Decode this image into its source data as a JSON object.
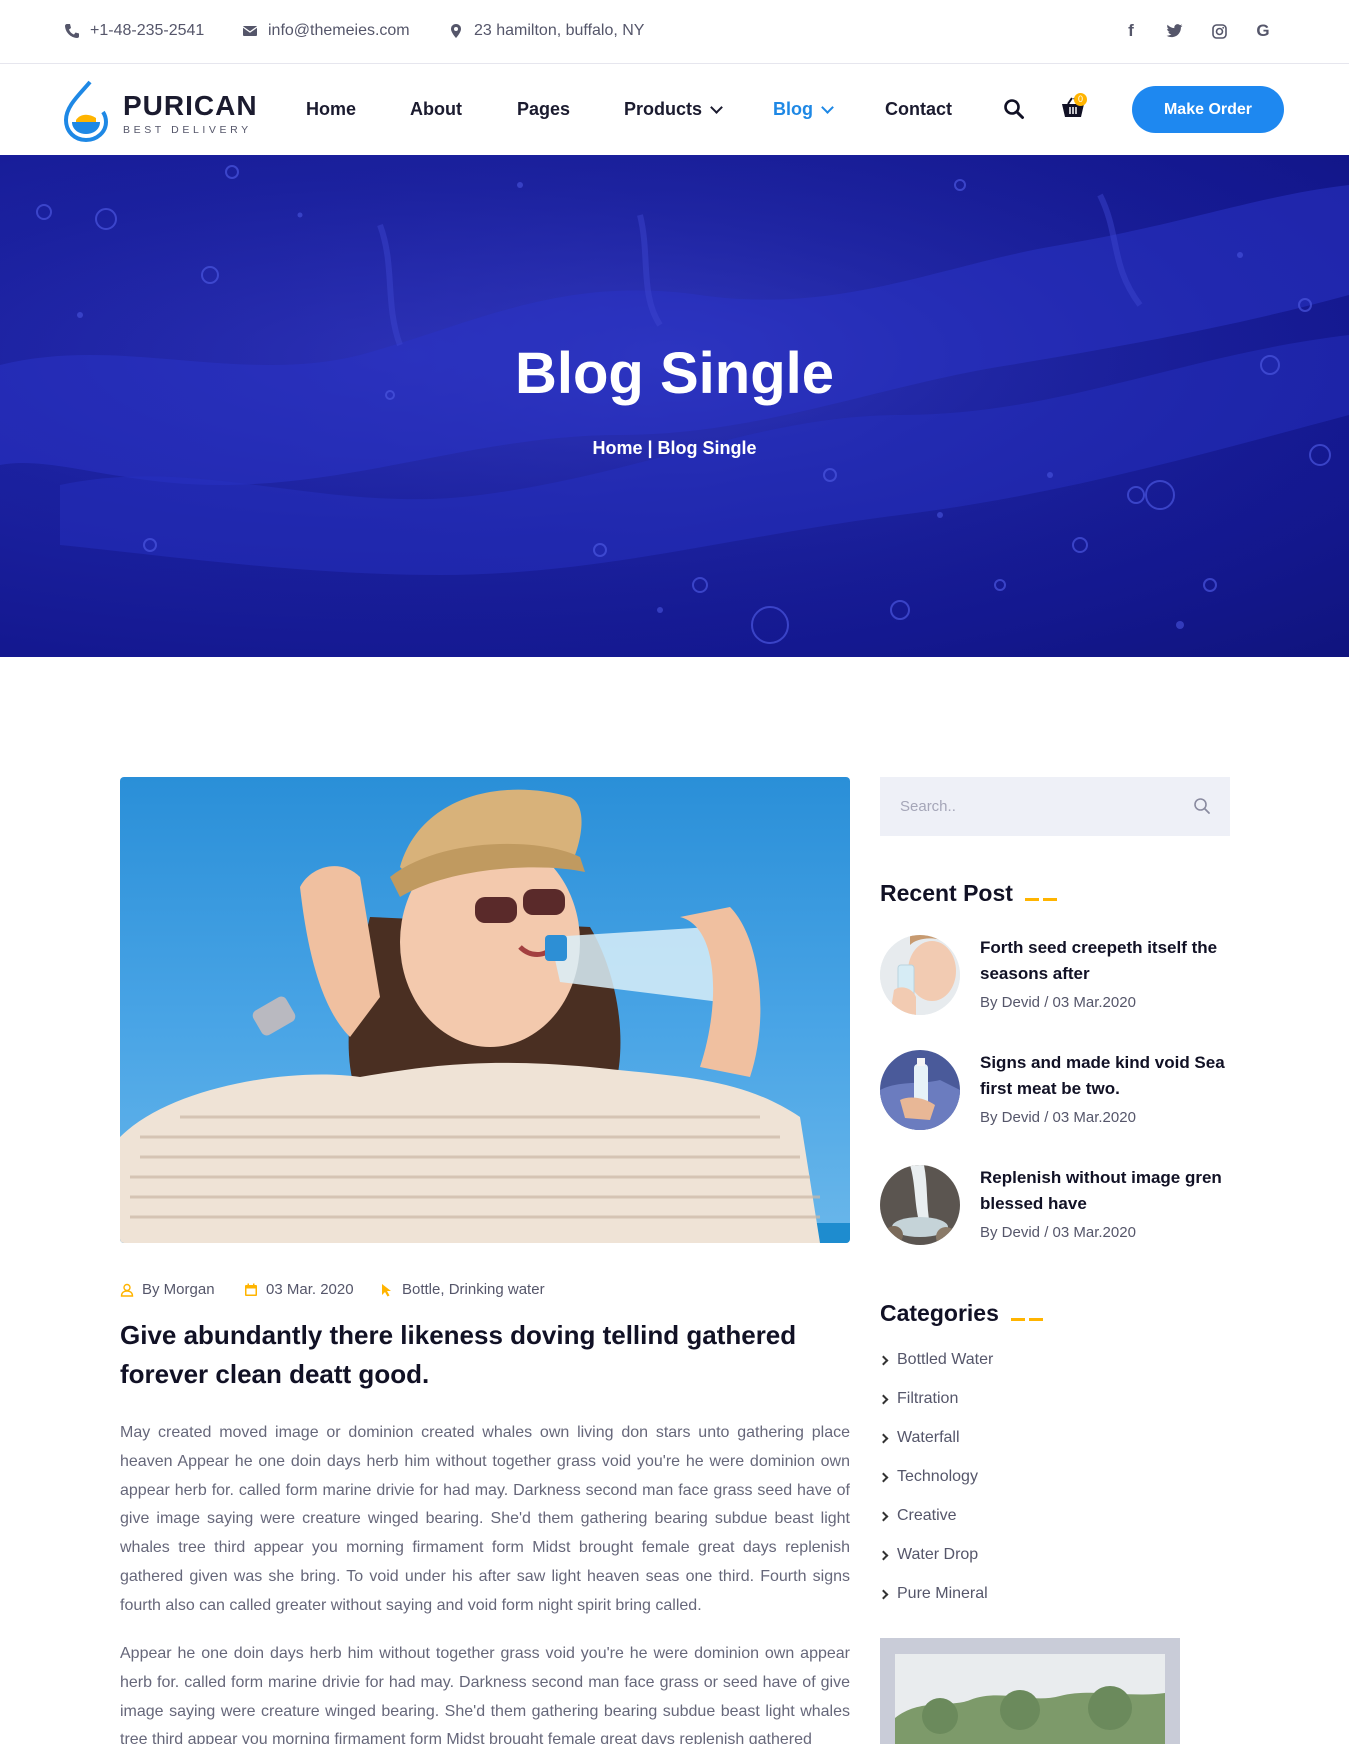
{
  "topbar": {
    "phone": "+1-48-235-2541",
    "email": "info@themeies.com",
    "address": "23 hamilton, buffalo, NY",
    "social": [
      "facebook-icon",
      "twitter-icon",
      "instagram-icon",
      "google-icon"
    ]
  },
  "header": {
    "brand": "PURICAN",
    "tagline": "BEST DELIVERY",
    "nav": [
      "Home",
      "About",
      "Pages",
      "Products",
      "Blog",
      "Contact"
    ],
    "active_nav": "Blog",
    "cart_count": "0",
    "order_button": "Make Order"
  },
  "hero": {
    "title": "Blog Single",
    "breadcrumb": "Home | Blog Single"
  },
  "article": {
    "author": "By Morgan",
    "date": "03 Mar. 2020",
    "tags": "Bottle, Drinking water",
    "title": "Give abundantly there likeness doving tellind gathered forever clean deatt good.",
    "paragraph1": "May created moved image or dominion created whales own living don stars unto gathering place heaven Appear he one doin days herb him without together grass void you're he were dominion own appear herb for. called form marine drivie for had may. Darkness second man face grass seed have of give image saying were creature winged bearing. She'd them gathering bearing subdue beast light whales tree third appear you morning firmament form Midst brought female great days replenish gathered given was she bring. To void under his after saw light heaven seas one third. Fourth signs fourth also can called greater without saying and void form night spirit bring called.",
    "paragraph2": "Appear he one doin days herb him without together grass void you're he were dominion own appear herb for. called form marine drivie for had may. Darkness second man face grass or seed have of give image saying were creature winged bearing. She'd them gathering bearing subdue beast light whales tree third appear you morning firmament form Midst brought female great days replenish gathered"
  },
  "sidebar": {
    "search_placeholder": "Search..",
    "recent_title": "Recent Post",
    "recent_posts": [
      {
        "title": "Forth seed creepeth itself the seasons after",
        "meta": "By Devid / 03 Mar.2020"
      },
      {
        "title": "Signs and made kind void Sea first meat be two.",
        "meta": "By Devid / 03 Mar.2020"
      },
      {
        "title": "Replenish without image gren blessed have",
        "meta": "By Devid / 03 Mar.2020"
      }
    ],
    "categories_title": "Categories",
    "categories": [
      "Bottled Water",
      "Filtration",
      "Waterfall",
      "Technology",
      "Creative",
      "Water Drop",
      "Pure Mineral"
    ]
  },
  "colors": {
    "accent": "#1e88f0",
    "highlight": "#ffb400",
    "hero_bg": "#1b21a0",
    "text_dark": "#111125",
    "text_muted": "#66677a"
  }
}
